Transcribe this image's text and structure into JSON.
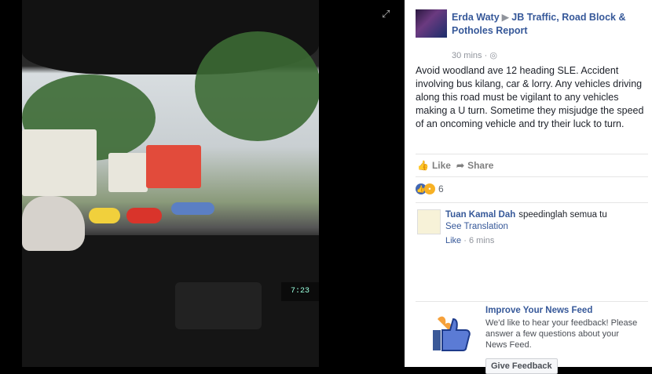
{
  "photo": {
    "clock": "7:23",
    "expand_icon": "expand-icon"
  },
  "post": {
    "author": "Erda Waty",
    "group": "JB Traffic, Road Block & Potholes Report",
    "time": "30 mins",
    "privacy_icon": "globe-icon",
    "text": "Avoid woodland ave 12 heading SLE. Accident involving bus kilang, car & lorry. Any vehicles driving along this road must be vigilant to any vehicles making a U turn. Sometime they misjudge the speed of an oncoming vehicle and try their luck to turn."
  },
  "actions": {
    "like": "Like",
    "share": "Share"
  },
  "reactions": {
    "count": "6"
  },
  "comment": {
    "author": "Tuan Kamal Dah",
    "text": "speedinglah semua tu",
    "translation": "See Translation",
    "like": "Like",
    "time": "6 mins"
  },
  "improve": {
    "title": "Improve Your News Feed",
    "description": "We'd like to hear your feedback! Please answer a few questions about your News Feed.",
    "button": "Give Feedback"
  },
  "colors": {
    "link": "#365899",
    "like_blue": "#4267b2"
  }
}
